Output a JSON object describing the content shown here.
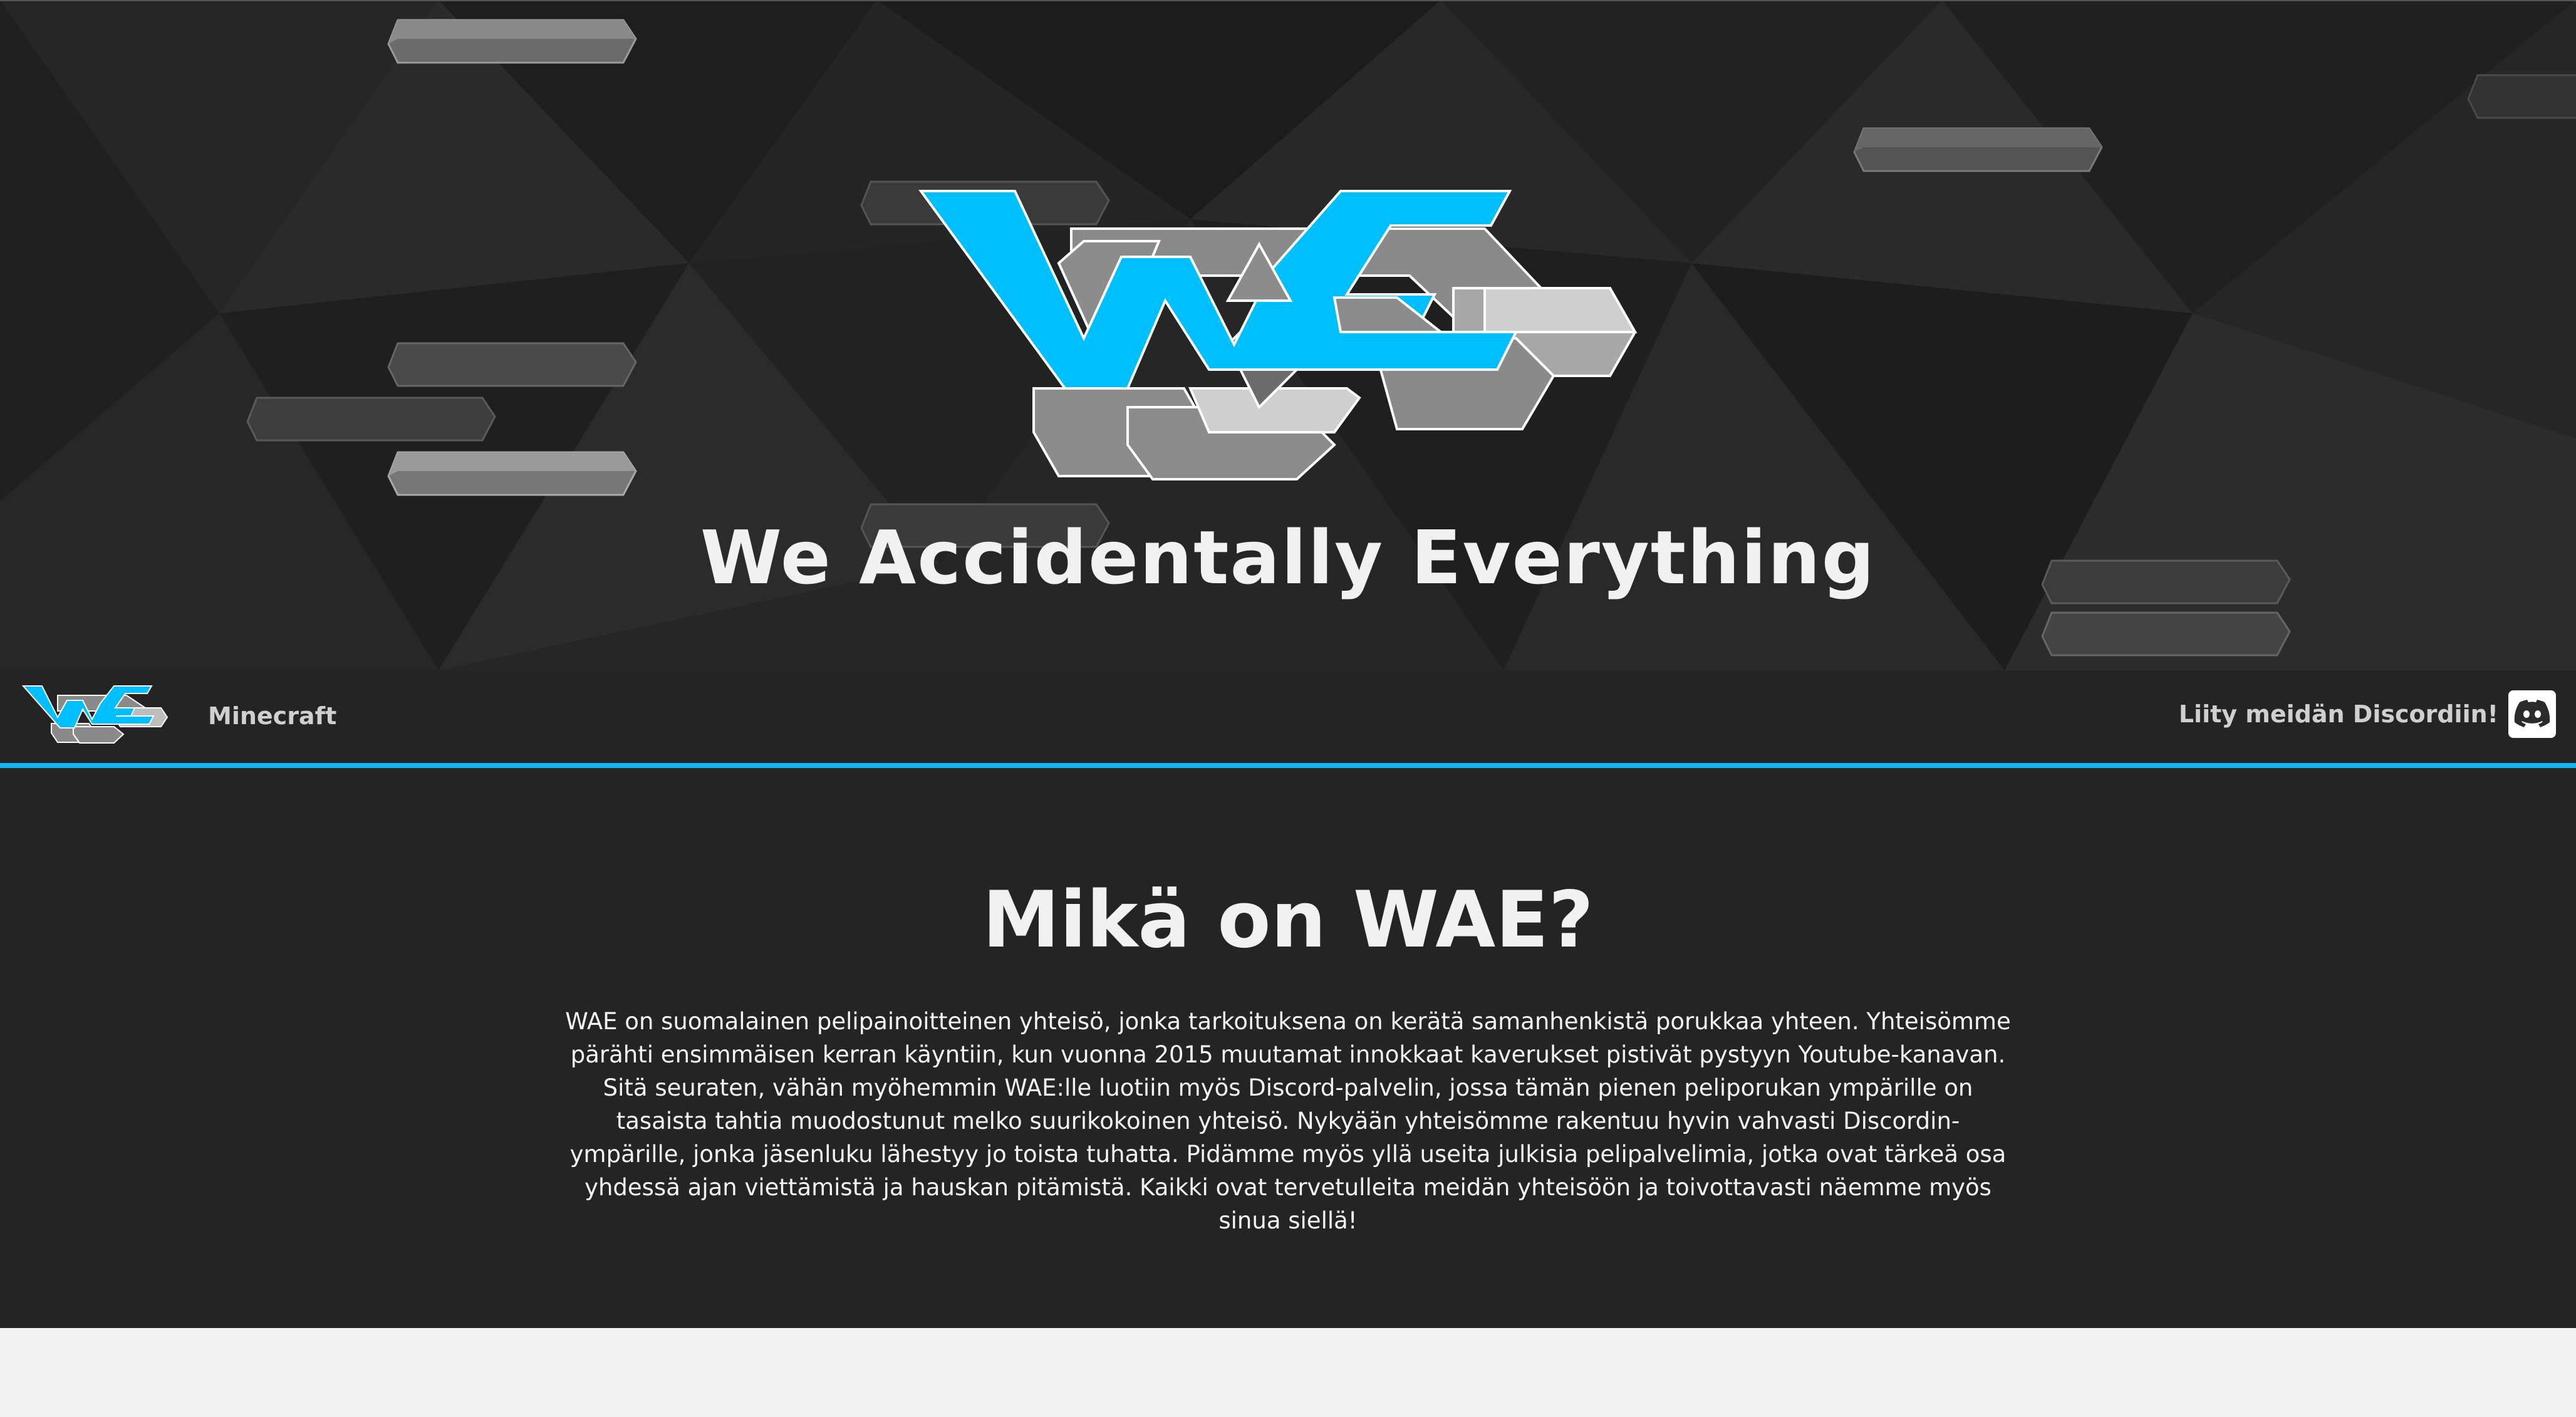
{
  "hero": {
    "title": "We Accidentally Everything",
    "logo_icon": "wae-logo"
  },
  "nav": {
    "logo_icon": "wae-logo",
    "links": [
      {
        "label": "Minecraft"
      }
    ],
    "discord_label": "Liity meidän Discordiin!",
    "discord_icon": "discord-icon"
  },
  "about": {
    "title": "Mikä on WAE?",
    "text": "WAE on suomalainen pelipainoitteinen yhteisö, jonka tarkoituksena on kerätä samanhenkistä porukkaa yhteen. Yhteisömme pärähti ensimmäisen kerran käyntiin, kun vuonna 2015 muutamat innokkaat kaverukset pistivät pystyyn Youtube-kanavan. Sitä seuraten, vähän myöhemmin WAE:lle luotiin myös Discord-palvelin, jossa tämän pienen peliporukan ympärille on tasaista tahtia muodostunut melko suurikokoinen yhteisö. Nykyään yhteisömme rakentuu hyvin vahvasti Discordin-ympärille, jonka jäsenluku lähestyy jo toista tuhatta. Pidämme myös yllä useita julkisia pelipalvelimia, jotka ovat tärkeä osa yhdessä ajan viettämistä ja hauskan pitämistä. Kaikki ovat tervetulleita meidän yhteisöön ja toivottavasti näemme myös sinua siellä!"
  },
  "colors": {
    "accent": "#0fb5ef",
    "background": "#242424",
    "hero_background": "#232323",
    "page_background": "#f2f2f2"
  }
}
